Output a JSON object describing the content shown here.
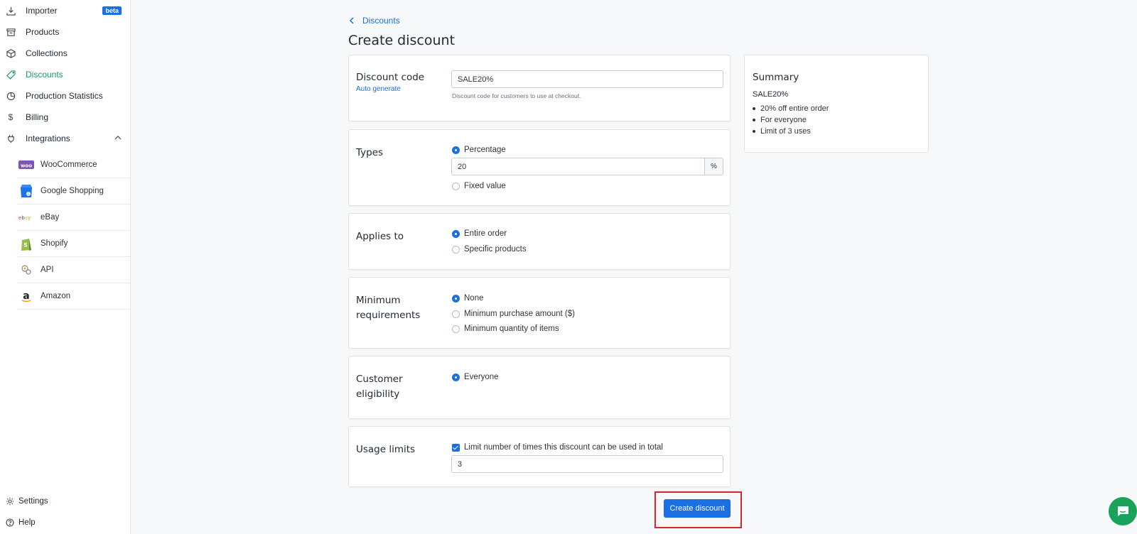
{
  "sidebar": {
    "items": [
      {
        "label": "Importer",
        "icon": "download-icon",
        "badge": "beta"
      },
      {
        "label": "Products",
        "icon": "archive-icon"
      },
      {
        "label": "Collections",
        "icon": "box-icon"
      },
      {
        "label": "Discounts",
        "icon": "tag-icon",
        "active": true
      },
      {
        "label": "Production Statistics",
        "icon": "pie-chart-icon"
      },
      {
        "label": "Billing",
        "icon": "dollar-icon"
      },
      {
        "label": "Integrations",
        "icon": "plug-icon",
        "expanded": true
      }
    ],
    "integrations": [
      {
        "label": "WooCommerce",
        "icon": "woocommerce-logo"
      },
      {
        "label": "Google Shopping",
        "icon": "google-shopping-logo"
      },
      {
        "label": "eBay",
        "icon": "ebay-logo"
      },
      {
        "label": "Shopify",
        "icon": "shopify-logo"
      },
      {
        "label": "API",
        "icon": "api-logo"
      },
      {
        "label": "Amazon",
        "icon": "amazon-logo"
      }
    ],
    "bottom": [
      {
        "label": "Settings",
        "icon": "gear-icon"
      },
      {
        "label": "Help",
        "icon": "help-icon"
      }
    ]
  },
  "breadcrumb": {
    "label": "Discounts"
  },
  "page": {
    "title": "Create discount"
  },
  "discount_code": {
    "label": "Discount code",
    "auto_generate": "Auto generate",
    "value": "SALE20%",
    "help": "Discount code for customers to use at checkout."
  },
  "types": {
    "label": "Types",
    "options": [
      "Percentage",
      "Fixed value"
    ],
    "selected": "Percentage",
    "value": "20",
    "suffix": "%"
  },
  "applies_to": {
    "label": "Applies to",
    "options": [
      "Entire order",
      "Specific products"
    ],
    "selected": "Entire order"
  },
  "minimum": {
    "label": "Minimum requirements",
    "options": [
      "None",
      "Minimum purchase amount ($)",
      "Minimum quantity of items"
    ],
    "selected": "None"
  },
  "eligibility": {
    "label": "Customer eligibility",
    "options": [
      "Everyone"
    ],
    "selected": "Everyone"
  },
  "usage": {
    "label": "Usage limits",
    "checkbox_label": "Limit number of times this discount can be used in total",
    "checked": true,
    "value": "3"
  },
  "summary": {
    "title": "Summary",
    "code": "SALE20%",
    "lines": [
      "20% off entire order",
      "For everyone",
      "Limit of 3 uses"
    ]
  },
  "actions": {
    "create_label": "Create discount"
  },
  "colors": {
    "accent": "#1b6fe0",
    "active_nav": "#1a9a5c",
    "chat": "#1aa25a",
    "highlight": "#d9262c"
  }
}
